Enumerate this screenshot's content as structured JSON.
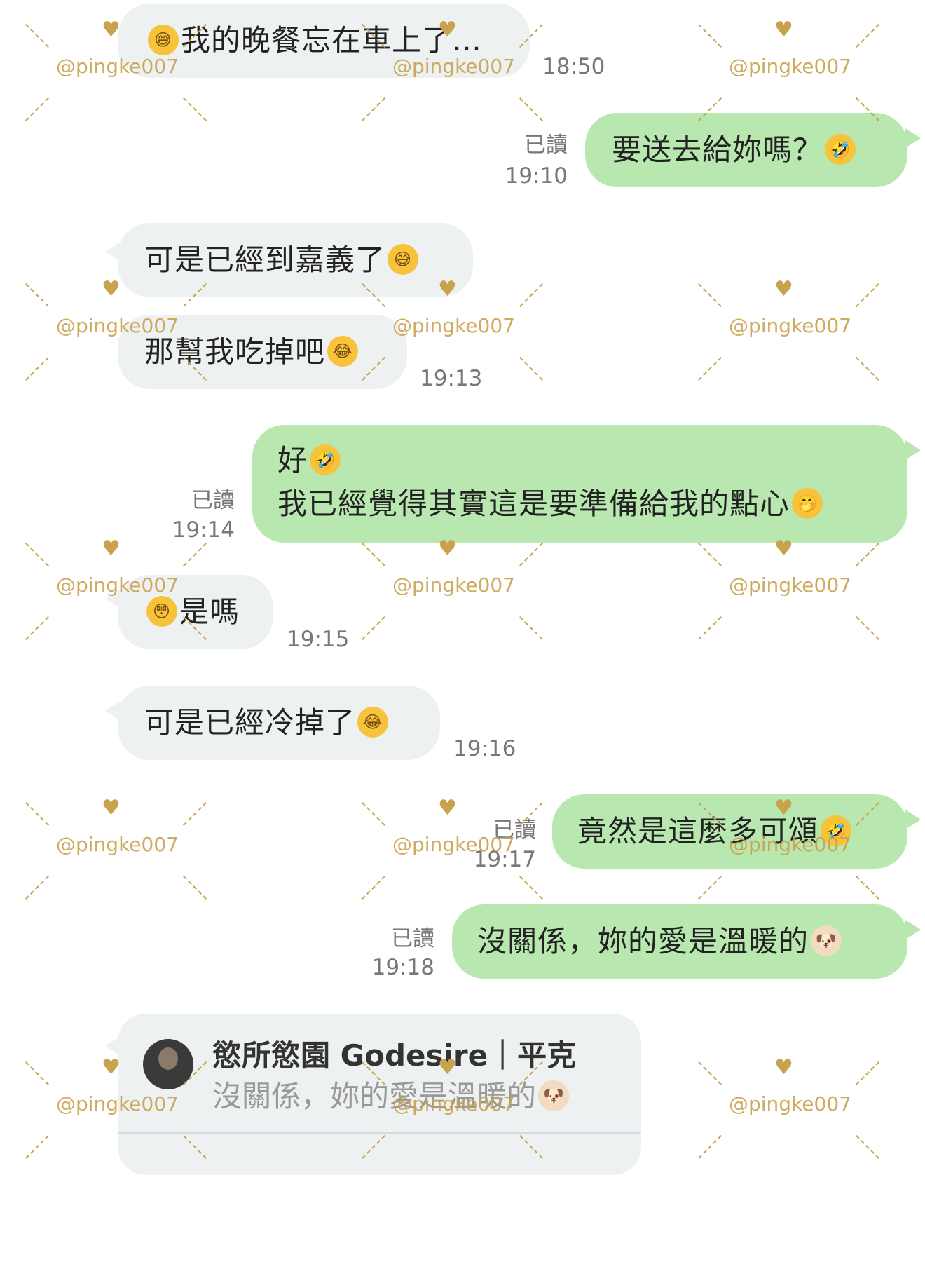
{
  "watermark": {
    "text": "@pingke007",
    "color": "#c9a24e"
  },
  "colors": {
    "incoming_bubble": "#eef1f2",
    "outgoing_bubble": "#b8e8b0",
    "meta_text": "#777777"
  },
  "messages": [
    {
      "dir": "in",
      "text": "我的晚餐忘在車上了…",
      "emoji_before": "sweat-smile-emoji",
      "emoji_after": "",
      "time": "18:50",
      "read": ""
    },
    {
      "dir": "out",
      "text": "要送去給妳嗎？",
      "emoji_after": "rofl-emoji",
      "time": "19:10",
      "read": "已讀"
    },
    {
      "dir": "in",
      "text": "可是已經到嘉義了",
      "emoji_after": "sweat-smile-emoji",
      "time": "",
      "read": ""
    },
    {
      "dir": "in",
      "text": "那幫我吃掉吧",
      "emoji_after": "joy-emoji",
      "time": "19:13",
      "read": ""
    },
    {
      "dir": "out",
      "line1": "好",
      "line1_emoji": "rofl-emoji",
      "line2": "我已經覺得其實這是要準備給我的點心",
      "emoji_after": "hand-over-mouth-emoji",
      "time": "19:14",
      "read": "已讀"
    },
    {
      "dir": "in",
      "text": "是嗎",
      "emoji_before": "flushed-emoji",
      "time": "19:15",
      "read": ""
    },
    {
      "dir": "in",
      "text": "可是已經冷掉了",
      "emoji_after": "joy-emoji",
      "time": "19:16",
      "read": ""
    },
    {
      "dir": "out",
      "text": "竟然是這麼多可頌",
      "emoji_after": "rofl-emoji",
      "time": "19:17",
      "read": "已讀"
    },
    {
      "dir": "out",
      "text": "沒關係，妳的愛是溫暖的",
      "emoji_after": "dog-emoji",
      "time": "19:18",
      "read": "已讀"
    }
  ],
  "reply": {
    "name": "慾所慾園 Godesire｜平克",
    "text": "沒關係，妳的愛是溫暖的"
  }
}
